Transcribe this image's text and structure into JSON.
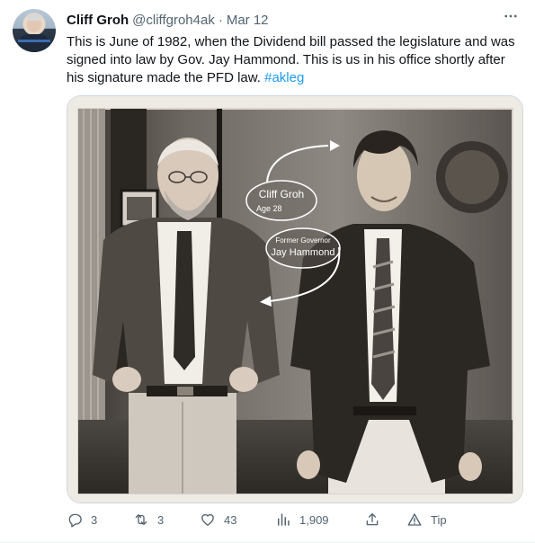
{
  "tweet": {
    "author_name": "Cliff Groh",
    "handle": "@cliffgroh4ak",
    "separator": "·",
    "date": "Mar 12",
    "text_main": "This is June of 1982, when the Dividend bill passed the legislature and was signed into law by Gov. Jay Hammond. This is us in his office shortly after his signature made the PFD law.",
    "hashtag": "#akleg"
  },
  "photo": {
    "label_1_name": "Cliff Groh",
    "label_1_age": "Age 28",
    "label_2_title": "Former Governor",
    "label_2_name": "Jay Hammond"
  },
  "actions": {
    "replies": "3",
    "retweets": "3",
    "likes": "43",
    "views": "1,909",
    "tip_label": "Tip"
  },
  "icons": [
    "avatar",
    "more-icon",
    "reply-icon",
    "retweet-icon",
    "like-icon",
    "views-icon",
    "share-icon",
    "tip-icon"
  ],
  "colors": {
    "hashtag": "#1d9bf0",
    "muted": "#536471",
    "text": "#0f1419"
  }
}
